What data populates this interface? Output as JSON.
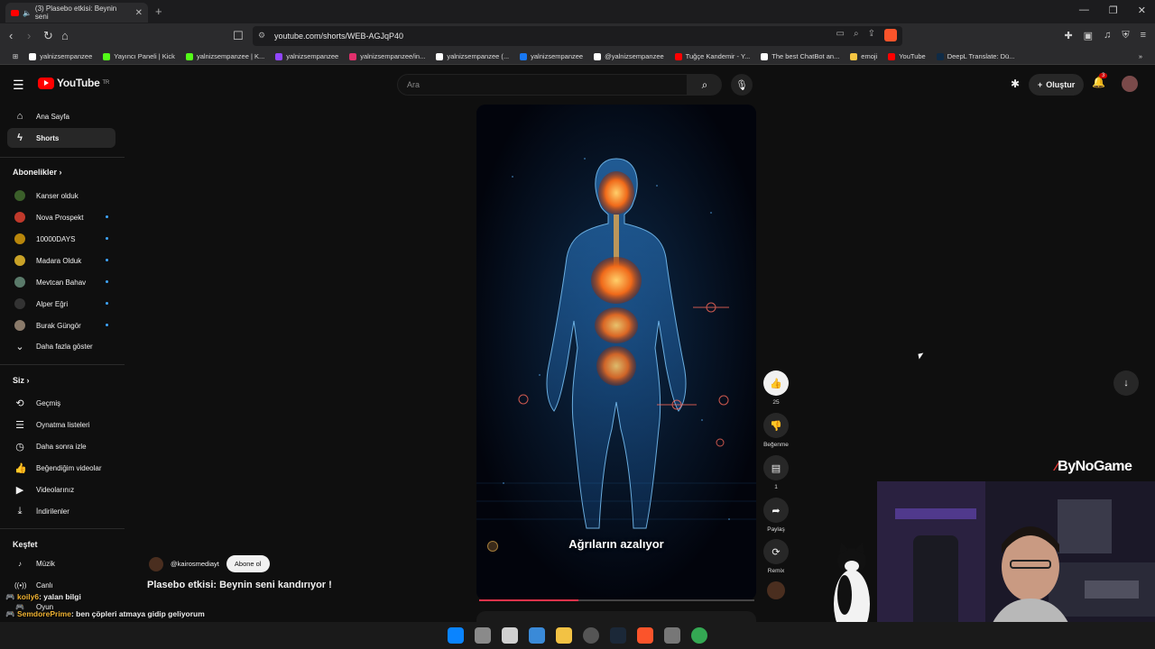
{
  "browser": {
    "tab_title": "(3) Plasebo etkisi: Beynin seni",
    "url": "youtube.com/shorts/WEB-AGJqP40",
    "bookmarks": [
      {
        "label": "yalnizsempanzee",
        "color": "#ffffff"
      },
      {
        "label": "Yayıncı Paneli | Kick",
        "color": "#53fc18"
      },
      {
        "label": "yalnizsempanzee | K...",
        "color": "#53fc18"
      },
      {
        "label": "yalnizsempanzee",
        "color": "#9146ff"
      },
      {
        "label": "yalnizsempanzee/in...",
        "color": "#e1306c"
      },
      {
        "label": "yalnizsempanzee (...",
        "color": "#ffffff"
      },
      {
        "label": "yalnizsempanzee",
        "color": "#1877f2"
      },
      {
        "label": "@yalnizsempanzee",
        "color": "#ffffff"
      },
      {
        "label": "Tuğçe Kandemir - Y...",
        "color": "#ff0000"
      },
      {
        "label": "The best ChatBot an...",
        "color": "#ffffff"
      },
      {
        "label": "emoji",
        "color": "#f5c542"
      },
      {
        "label": "YouTube",
        "color": "#ff0000"
      },
      {
        "label": "DeepL Translate: Dü...",
        "color": "#0f2b46"
      }
    ]
  },
  "youtube": {
    "logo": "YouTube",
    "logo_country": "TR",
    "search_placeholder": "Ara",
    "create_label": "Oluştur",
    "notification_count": "3"
  },
  "sidebar": {
    "home": "Ana Sayfa",
    "shorts": "Shorts",
    "subs_header": "Abonelikler",
    "subscriptions": [
      {
        "label": "Kanser olduk",
        "color": "#3b5f2a"
      },
      {
        "label": "Nova Prospekt",
        "color": "#c0392b"
      },
      {
        "label": "10000DAYS",
        "color": "#b8860b"
      },
      {
        "label": "Madara Olduk",
        "color": "#c9a227"
      },
      {
        "label": "Mevtcan Bahav",
        "color": "#5a7a6a"
      },
      {
        "label": "Alper Eğri",
        "color": "#333333"
      },
      {
        "label": "Burak Güngör",
        "color": "#8a7a6a"
      }
    ],
    "show_more": "Daha fazla göster",
    "you_header": "Siz",
    "you_items": [
      "Geçmiş",
      "Oynatma listeleri",
      "Daha sonra izle",
      "Beğendiğim videolar",
      "Videolarınız",
      "İndirilenler"
    ],
    "explore_header": "Keşfet",
    "explore_items": [
      "Müzik",
      "Canlı",
      "Oyun"
    ]
  },
  "short": {
    "caption": "Ağrıların azalıyor",
    "channel": "@kairosmediayt",
    "subscribe": "Abone ol",
    "title": "Plasebo etkisi: Beynin seni kandırıyor !",
    "progress": 0.36,
    "likes": "25",
    "dislike_label": "Beğenme",
    "comments": "1",
    "share_label": "Paylaş",
    "remix_label": "Remix"
  },
  "overlay": {
    "chat": [
      {
        "user": "koily6",
        "text": ": yalan bilgi"
      },
      {
        "user": "SemdorePrime",
        "text": ": ben çöpleri atmaya gidip geliyorum"
      }
    ],
    "watermark": "ByNoGame"
  }
}
